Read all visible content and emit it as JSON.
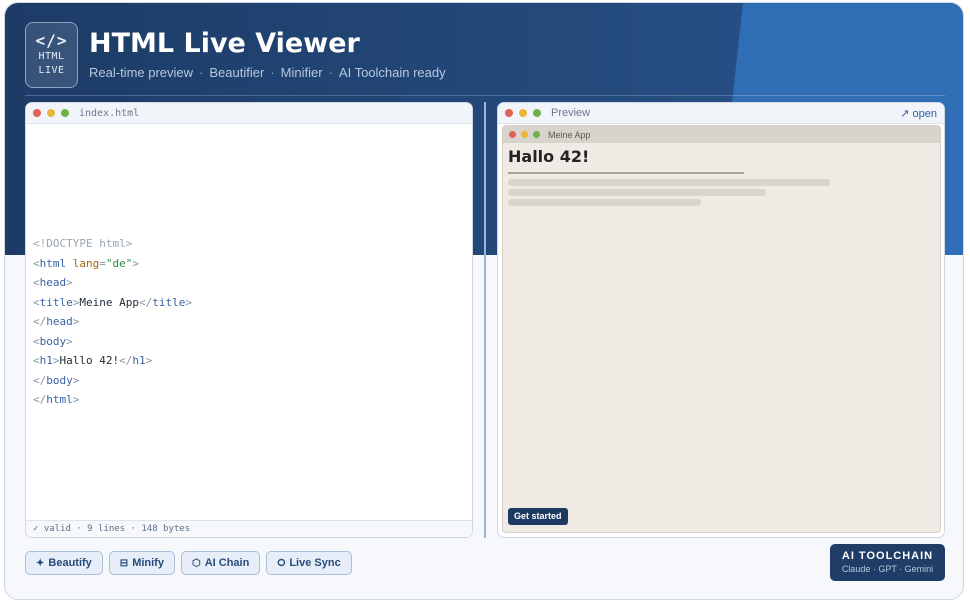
{
  "app": {
    "title": "HTML Live Viewer",
    "logo_glyph": "</>",
    "logo_line1": "HTML",
    "logo_line2": "LIVE",
    "subtitle_items": [
      "Real-time preview",
      "Beautifier",
      "Minifier",
      "AI Toolchain ready"
    ],
    "subtitle_separator": "·"
  },
  "editor": {
    "filename": "index.html",
    "status": "✓ valid · 9 lines · 148 bytes"
  },
  "preview": {
    "label": "Preview",
    "open_label": "↗ open",
    "inner_title": "Meine App",
    "heading": "Hallo 42!",
    "cta_label": "Get started"
  },
  "toolbar": {
    "beautify": {
      "icon": "✦",
      "label": "Beautify"
    },
    "minify": {
      "icon": "⊟",
      "label": "Minify"
    },
    "ai_chain": {
      "icon": "⬡",
      "label": "AI Chain"
    },
    "live_sync": {
      "icon": "⭘",
      "label": "Live Sync"
    }
  },
  "ai_badge": {
    "title": "AI TOOLCHAIN",
    "models": "Claude · GPT · Gemini"
  },
  "colors": {
    "hero": "#1d3b66",
    "hero_accent": "#2f6db5",
    "button_dark": "#1d3a62",
    "tag": "#3a63a6",
    "attr": "#a0661b",
    "value": "#2a8a52"
  },
  "icons": {
    "window_controls": [
      "close-dot",
      "minimize-dot",
      "maximize-dot"
    ],
    "logo": "code-brackets-icon"
  }
}
